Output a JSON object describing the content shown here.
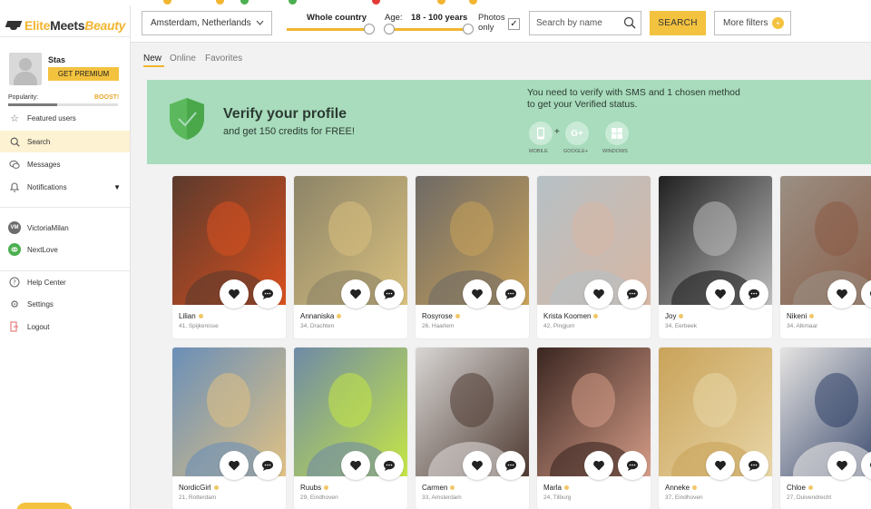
{
  "app": {
    "logo_part1": "Elite",
    "logo_part2": "Meets",
    "logo_part3": "Beauty"
  },
  "profile": {
    "name": "Stas",
    "premium_label": "GET PREMIUM",
    "popularity_label": "Popularity:",
    "boost_label": "BOOST!",
    "popularity": 0.45
  },
  "sidebar": {
    "items": [
      {
        "label": "Featured users",
        "icon": "star-icon"
      },
      {
        "label": "Search",
        "icon": "search-icon"
      },
      {
        "label": "Messages",
        "icon": "chat-icon"
      },
      {
        "label": "Notifications",
        "icon": "bell-icon"
      }
    ],
    "sites": [
      {
        "label": "VictoriaMilan",
        "badge": "VM"
      },
      {
        "label": "NextLove",
        "badge": ""
      }
    ],
    "bottom": [
      {
        "label": "Help Center",
        "icon": "help-icon"
      },
      {
        "label": "Settings",
        "icon": "gear-icon"
      },
      {
        "label": "Logout",
        "icon": "logout-icon"
      }
    ]
  },
  "filters": {
    "location": "Amsterdam, Netherlands",
    "distance_label": "Whole country",
    "age_label": "Age:",
    "age_value": "18 - 100 years",
    "photos_label_1": "Photos",
    "photos_label_2": "only",
    "photos_checked": "✓",
    "search_placeholder": "Search by name",
    "search_button": "SEARCH",
    "more_filters": "More filters",
    "more_filters_badge": "+"
  },
  "tabs": [
    "New",
    "Online",
    "Favorites"
  ],
  "banner": {
    "title": "Verify your profile",
    "subtitle": "and get 150 credits for FREE!",
    "right_text": "You need to verify with SMS and 1 chosen method to get your Verified status.",
    "plus": "+",
    "options": [
      {
        "label": "MOBILE",
        "glyph": ""
      },
      {
        "label": "GOOGLE+",
        "glyph": "G+"
      },
      {
        "label": "WINDOWS",
        "glyph": ""
      }
    ]
  },
  "colors": {
    "accent": "#f3c23f",
    "banner": "#a8dcbc",
    "online": "#f1c768"
  },
  "cards": [
    {
      "name": "Lilian",
      "meta": "41, Spijkenisse",
      "bg": "#5b3a2d",
      "fg": "#d8501f"
    },
    {
      "name": "Annaniska",
      "meta": "34, Drachten",
      "bg": "#8c8468",
      "fg": "#d9c07e"
    },
    {
      "name": "Rosyrose",
      "meta": "26, Haarlem",
      "bg": "#6e6a66",
      "fg": "#c9a25a"
    },
    {
      "name": "Krista Koomen",
      "meta": "42, Pingjum",
      "bg": "#b6c0c5",
      "fg": "#d7b7a4"
    },
    {
      "name": "Joy",
      "meta": "34, Eerbeek",
      "bg": "#202020",
      "fg": "#bdbdbd"
    },
    {
      "name": "Nikeni",
      "meta": "34, Alkmaar",
      "bg": "#9a8f83",
      "fg": "#8a5a44"
    },
    {
      "name": "NordicGirl",
      "meta": "21, Rotterdam",
      "bg": "#6a8fb8",
      "fg": "#e0c183"
    },
    {
      "name": "Ruubs",
      "meta": "29, Eindhoven",
      "bg": "#6f8aa6",
      "fg": "#c5e646"
    },
    {
      "name": "Carmen",
      "meta": "33, Amsterdam",
      "bg": "#d8d6d4",
      "fg": "#4e3a31"
    },
    {
      "name": "Marla",
      "meta": "24, Tilburg",
      "bg": "#3a2621",
      "fg": "#d59c87"
    },
    {
      "name": "Anneke",
      "meta": "37, Eindhoven",
      "bg": "#c9a35a",
      "fg": "#e8d5a6"
    },
    {
      "name": "Chloe",
      "meta": "27, Duivendrecht",
      "bg": "#e6e4e2",
      "fg": "#2e3f66"
    }
  ]
}
